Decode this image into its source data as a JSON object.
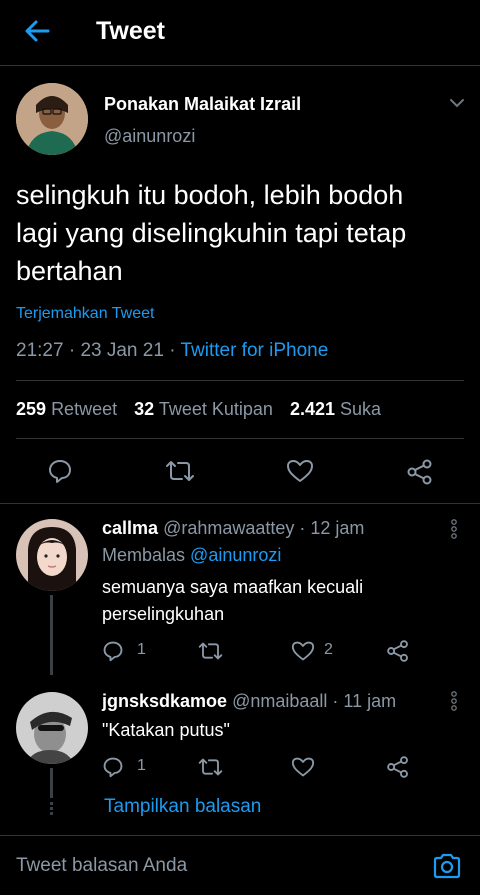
{
  "header": {
    "title": "Tweet"
  },
  "tweet": {
    "author_name": "Ponakan Malaikat Izrail",
    "author_handle": "@ainunrozi",
    "text_line1": "selingkuh itu bodoh, lebih bodoh",
    "text_line2": "lagi yang diselingkuhin tapi tetap",
    "text_line3": "bertahan",
    "translate": "Terjemahkan Tweet",
    "time": "21:27",
    "date": "23 Jan 21",
    "sep1": "·",
    "sep2": "·",
    "source": "Twitter for iPhone",
    "retweets_count": "259",
    "retweets_label": "Retweet",
    "quotes_count": "32",
    "quotes_label": "Tweet Kutipan",
    "likes_count": "2.421",
    "likes_label": "Suka"
  },
  "replies": [
    {
      "name": "callma",
      "handle": "@rahmawaattey",
      "time": "· 12 jam",
      "replying_label": "Membalas",
      "replying_to": "@ainunrozi",
      "text_line1": "semuanya saya maafkan kecuali",
      "text_line2": "perselingkuhan",
      "reply_count": "1",
      "like_count": "2"
    },
    {
      "name": "jgnsksdkamoe",
      "handle": "@nmaibaall",
      "time": "· 11 jam",
      "text_line1": "\"Katakan putus\"",
      "reply_count": "1"
    }
  ],
  "show_replies": "Tampilkan balasan",
  "reply_input": {
    "placeholder": "Tweet balasan Anda"
  },
  "colors": {
    "accent": "#1d9bf0",
    "background": "#000000",
    "muted": "#8b98a5",
    "divider": "#2f3336"
  },
  "icons": [
    "back-arrow-icon",
    "chevron-down-icon",
    "reply-icon",
    "retweet-icon",
    "like-icon",
    "share-icon",
    "more-vertical-icon",
    "camera-icon"
  ]
}
